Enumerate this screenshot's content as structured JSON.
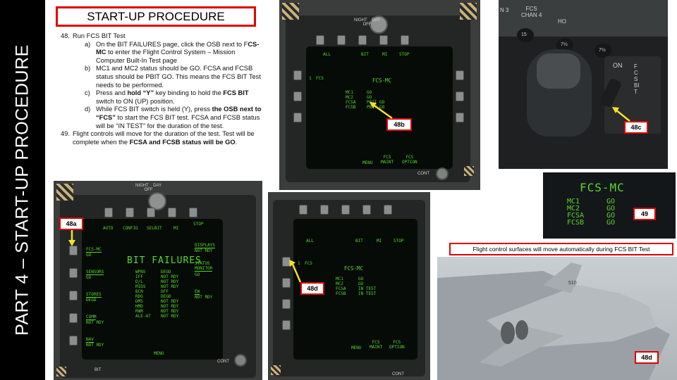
{
  "sidebar": {
    "text": "PART 4 – START-UP PROCEDURE"
  },
  "title": "START-UP PROCEDURE",
  "steps": [
    {
      "num": "48.",
      "text": "Run FCS BIT Test",
      "subs": [
        {
          "letter": "a)",
          "html": "On the BIT FAILURES page, click the OSB next to F<b>CS-MC</b> to enter the Flight Control System – Mission Computer Built-In Test page"
        },
        {
          "letter": "b)",
          "html": "MC1 and MC2 status should be GO. FCSA and FCSB status should be PBIT GO. This means the FCS BIT Test needs to be performed."
        },
        {
          "letter": "c)",
          "html": "Press and <b>hold “Y”</b> key binding to hold the <b>FCS BIT</b> switch to ON (UP) position."
        },
        {
          "letter": "d)",
          "html": "While FCS BIT switch is held (Y), press <b>the OSB next to “FCS”</b> to start the FCS BIT test. FCSA and FCSB status will be “IN TEST” for the duration of the test."
        }
      ]
    },
    {
      "num": "49.",
      "html": "Flight controls will move for the duration of the test. Test will be complete when the <b>FCSA and FCSB status will be GO</b>.",
      "subs": []
    }
  ],
  "ddi_48b": {
    "knob_label": "NIGHT    DAY\nOFF",
    "top_osb": [
      "ALL",
      "BIT",
      "MI",
      "STOP"
    ],
    "left_osb": "FCS",
    "left_osb_num": "1",
    "page_title": "FCS-MC",
    "rows": [
      [
        "MC1",
        "GO"
      ],
      [
        "MC2",
        "GO"
      ],
      [
        "FCSA",
        "PBIT GO"
      ],
      [
        "FCSB",
        "PBIT GO"
      ]
    ],
    "bottom_osb": [
      "MENU",
      "FCS\nMAINT",
      "FCS\nOPTION"
    ],
    "cont": "CONT",
    "callout": "48b"
  },
  "ddi_48a": {
    "knob_label": "NIGHT    DAY\nOFF",
    "top_osb": [
      "AUTO",
      "CONFIG",
      "SELBIT",
      "MI",
      "STOP"
    ],
    "left_osb": [
      [
        "FCS-MC",
        "GO"
      ],
      [
        "SENSORS",
        "GO"
      ],
      [
        "STORES",
        "DEGD"
      ],
      [
        "COMM",
        "NOT RDY"
      ],
      [
        "NAV",
        "NOT RDY"
      ]
    ],
    "right_osb": [
      [
        "DISPLAYS",
        "NOT RDY"
      ],
      [
        "STATUS\nMONITOR",
        "GO"
      ],
      [
        "EW",
        "NOT RDY"
      ]
    ],
    "page_title": "BIT FAILURES",
    "rows": [
      [
        "WPNS",
        "DEGD"
      ],
      [
        "IFF",
        "NOT RDY"
      ],
      [
        "D/L",
        "NOT RDY"
      ],
      [
        "MIDS",
        "NOT RDY"
      ],
      [
        "BCN",
        "OFF"
      ],
      [
        "RDG",
        "DEGD"
      ],
      [
        "DMS",
        "NOT RDY"
      ],
      [
        "HMD",
        "NOT RDY"
      ],
      [
        "RWR",
        "NOT RDY"
      ],
      [
        "ALE-47",
        "NOT RDY"
      ]
    ],
    "bottom": "MENU",
    "bit": "BIT",
    "cont": "CONT",
    "callout": "48a"
  },
  "ddi_48d": {
    "top_osb": [
      "ALL",
      "BIT",
      "MI",
      "STOP"
    ],
    "left_osb": "FCS",
    "left_osb_num": "1",
    "page_title": "FCS-MC",
    "rows": [
      [
        "MC1",
        "GO"
      ],
      [
        "MC2",
        "GO"
      ],
      [
        "FCSA",
        "IN TEST"
      ],
      [
        "FCSB",
        "IN TEST"
      ]
    ],
    "bottom_osb": [
      "MENU",
      "FCS\nMAINT",
      "FCS\nOPTION"
    ],
    "cont": "CONT",
    "callout": "48d"
  },
  "panel_48c": {
    "labels": [
      "FCS\nCHAN 4",
      "N 3",
      "HO",
      "15",
      "7½",
      "7½",
      "ON",
      "FCS BIT"
    ],
    "callout": "48c"
  },
  "zoom_49": {
    "title": "FCS-MC",
    "rows": [
      [
        "MC1",
        "GO"
      ],
      [
        "MC2",
        "GO"
      ],
      [
        "FCSA",
        "GO"
      ],
      [
        "FCSB",
        "GO"
      ]
    ],
    "callout": "49"
  },
  "caption": "Flight control surfaces will move automatically during FCS BIT Test",
  "jet": {
    "tail_code": "510",
    "callout": "48d"
  },
  "colors": {
    "accent_red": "#e00000",
    "mfd_green": "#58d72b"
  }
}
